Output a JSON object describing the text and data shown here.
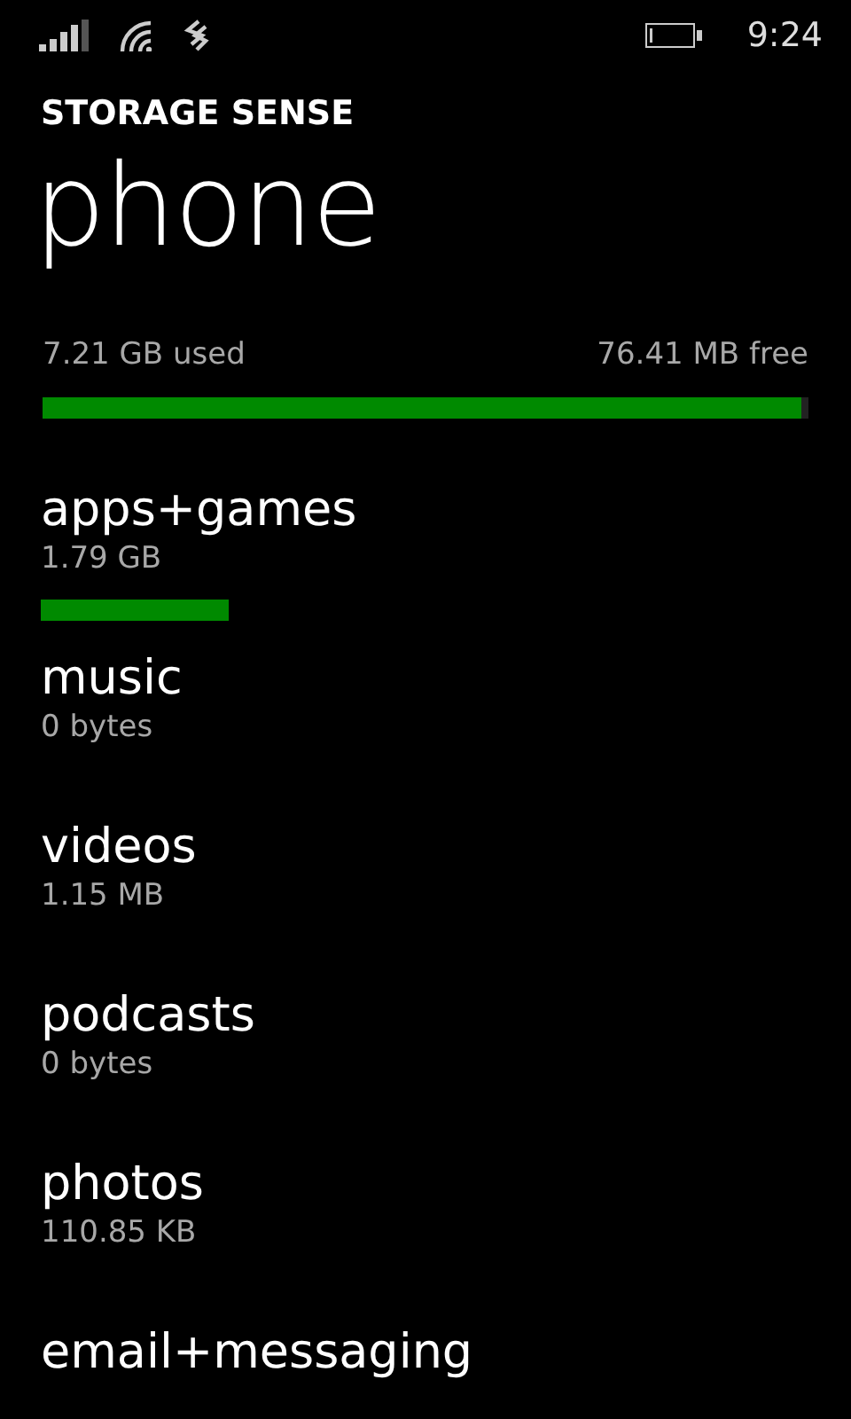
{
  "status_bar": {
    "time": "9:24"
  },
  "header": {
    "app_title": "STORAGE SENSE",
    "page_title": "phone"
  },
  "summary": {
    "used": "7.21 GB used",
    "free": "76.41 MB free",
    "level": 0.991
  },
  "categories": [
    {
      "name": "apps+games",
      "size": "1.79 GB",
      "bar": true
    },
    {
      "name": "music",
      "size": "0 bytes"
    },
    {
      "name": "videos",
      "size": "1.15 MB"
    },
    {
      "name": "podcasts",
      "size": "0 bytes"
    },
    {
      "name": "photos",
      "size": "110.85 KB"
    },
    {
      "name": "email+messaging"
    }
  ]
}
